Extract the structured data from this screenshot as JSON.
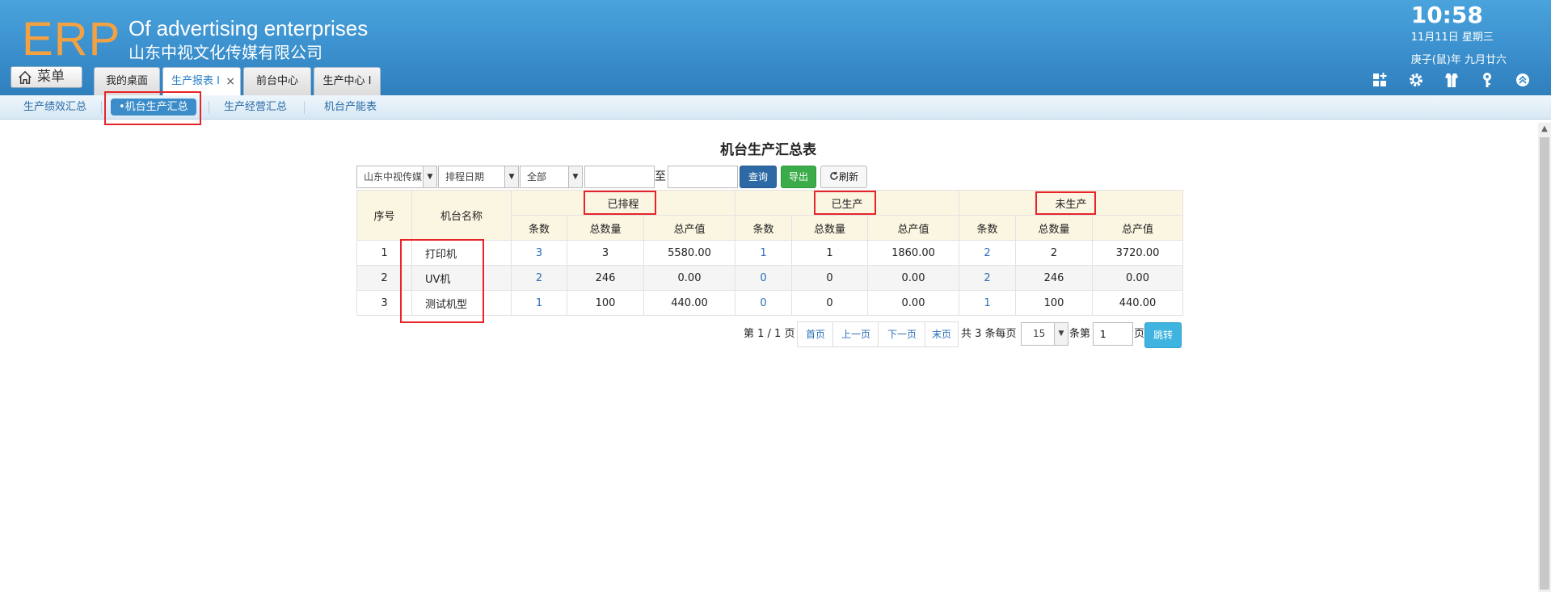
{
  "header": {
    "logo": "ERP",
    "slogan": "Of advertising enterprises",
    "company": "山东中视文化传媒有限公司",
    "time": "10:58",
    "date": "11月11日 星期三",
    "lunar": "庚子(鼠)年 九月廿六",
    "menu_label": "菜单",
    "tabs": [
      {
        "label": "我的桌面",
        "close": ""
      },
      {
        "label": "生产报表 I",
        "close": "×"
      },
      {
        "label": "前台中心",
        "close": ""
      },
      {
        "label": "生产中心 I",
        "close": ""
      }
    ],
    "icons": [
      "apps-add-icon",
      "gear-icon",
      "shirt-icon",
      "key-icon",
      "collapse-up-icon"
    ]
  },
  "subnav": {
    "items": [
      "生产绩效汇总",
      "•机台生产汇总",
      "生产经营汇总",
      "机台产能表"
    ]
  },
  "report": {
    "title": "机台生产汇总表",
    "filters": {
      "company": "山东中视传媒",
      "date_type": "排程日期",
      "status": "全部",
      "start_date": "",
      "to_label": "至",
      "end_date": ""
    },
    "buttons": {
      "query": "查询",
      "export": "导出",
      "refresh": "刷新"
    },
    "columns": {
      "seq": "序号",
      "machine": "机台名称",
      "groups": [
        "已排程",
        "已生产",
        "未生产"
      ],
      "sub": [
        "条数",
        "总数量",
        "总产值"
      ]
    },
    "rows": [
      {
        "seq": "1",
        "name": "打印机",
        "v": [
          "3",
          "3",
          "5580.00",
          "1",
          "1",
          "1860.00",
          "2",
          "2",
          "3720.00"
        ]
      },
      {
        "seq": "2",
        "name": "UV机",
        "v": [
          "2",
          "246",
          "0.00",
          "0",
          "0",
          "0.00",
          "2",
          "246",
          "0.00"
        ]
      },
      {
        "seq": "3",
        "name": "测试机型",
        "v": [
          "1",
          "100",
          "440.00",
          "0",
          "0",
          "0.00",
          "1",
          "100",
          "440.00"
        ]
      }
    ]
  },
  "pager": {
    "page_info": "第 1 / 1 页",
    "first": "首页",
    "prev": "上一页",
    "next": "下一页",
    "last": "末页",
    "total": "共 3 条每页",
    "page_size": "15",
    "items_label": "条第",
    "page_input": "1",
    "page_label": "页",
    "go": "跳转"
  }
}
